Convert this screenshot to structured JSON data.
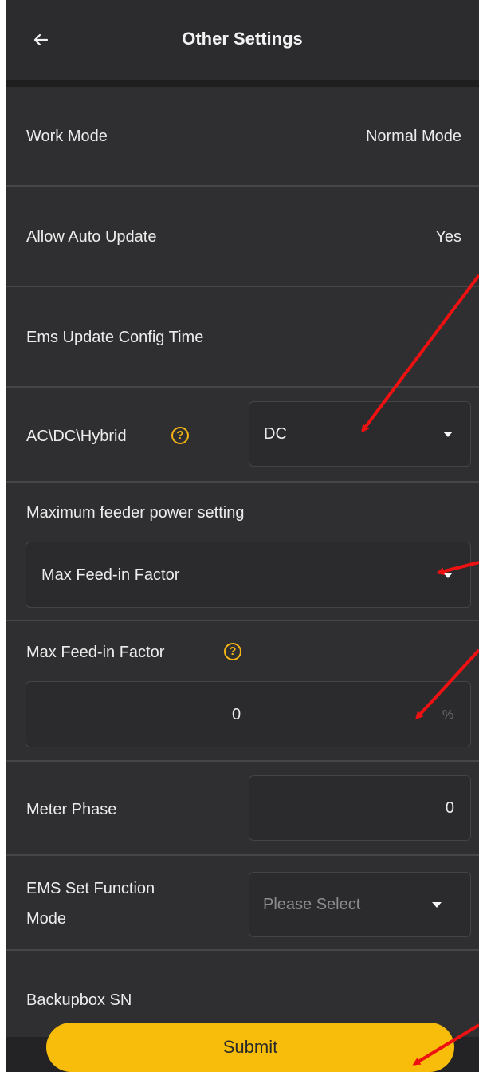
{
  "header": {
    "title": "Other Settings",
    "back_icon": "arrow-left-icon"
  },
  "rows": {
    "work_mode": {
      "label": "Work Mode",
      "value": "Normal Mode"
    },
    "auto_update": {
      "label": "Allow Auto Update",
      "value": "Yes"
    },
    "ems_update": {
      "label": "Ems Update Config Time"
    },
    "ac_dc": {
      "label": "AC\\DC\\Hybrid",
      "help_icon": "question-circle-icon",
      "selected": "DC"
    },
    "max_feeder": {
      "label": "Maximum feeder power setting",
      "selected": "Max Feed-in Factor"
    },
    "feed_in_factor": {
      "label": "Max Feed-in Factor",
      "help_icon": "question-circle-icon",
      "value": "0",
      "unit": "%"
    },
    "meter_phase": {
      "label": "Meter Phase",
      "value": "0"
    },
    "ems_function": {
      "label_line1": "EMS Set Function",
      "label_line2": "Mode",
      "placeholder": "Please Select"
    },
    "backupbox": {
      "label": "Backupbox SN"
    }
  },
  "footer": {
    "submit_label": "Submit"
  },
  "colors": {
    "background": "#2f2f31",
    "accent": "#f8bd0a",
    "annotation_arrow": "#ee1111"
  }
}
